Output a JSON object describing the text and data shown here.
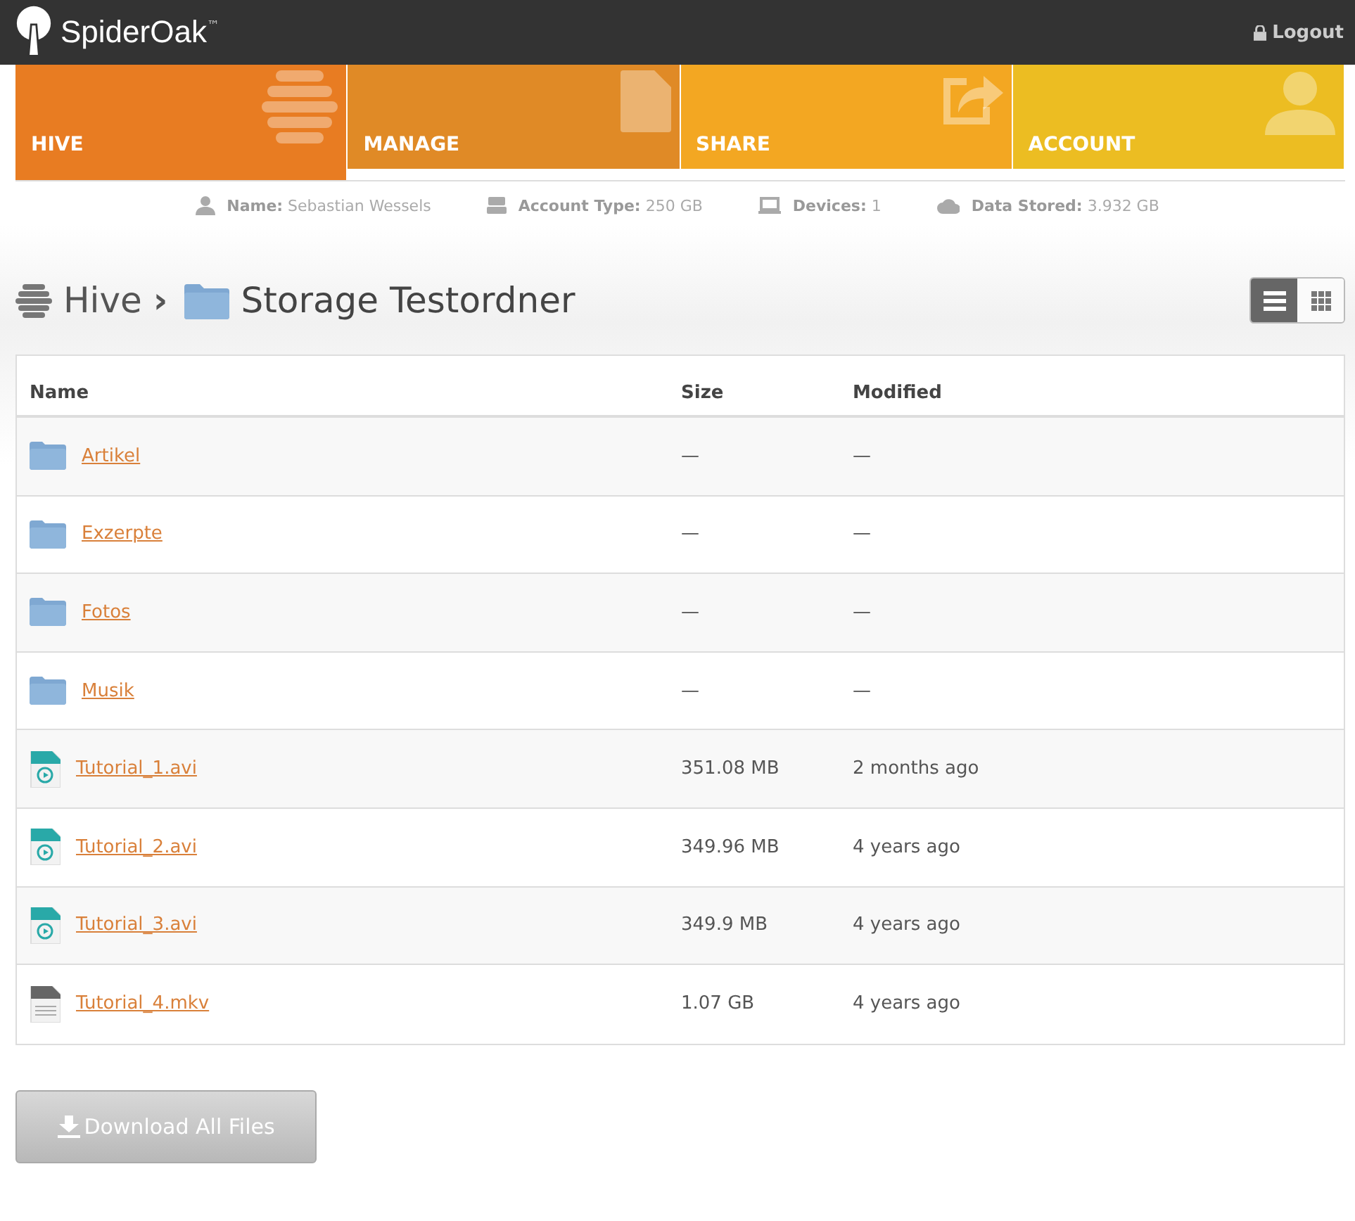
{
  "header": {
    "brand": "SpiderOak",
    "trademark": "™",
    "logout": "Logout"
  },
  "tabs": [
    {
      "label": "HIVE",
      "selected": true,
      "color": "#e87c22",
      "kind": "hive"
    },
    {
      "label": "MANAGE",
      "selected": false,
      "color": "#e08a26",
      "kind": "document"
    },
    {
      "label": "SHARE",
      "selected": false,
      "color": "#f3a722",
      "kind": "share"
    },
    {
      "label": "ACCOUNT",
      "selected": false,
      "color": "#ecbd22",
      "kind": "person"
    }
  ],
  "account_info": [
    {
      "kind": "person",
      "label": "Name:",
      "value": "Sebastian Wessels"
    },
    {
      "kind": "drive",
      "label": "Account Type:",
      "value": "250 GB"
    },
    {
      "kind": "laptop",
      "label": "Devices:",
      "value": "1"
    },
    {
      "kind": "cloud",
      "label": "Data Stored:",
      "value": "3.932 GB"
    }
  ],
  "breadcrumb": {
    "root": "Hive",
    "separator": "›",
    "current": "Storage Testordner"
  },
  "view_toggle": [
    {
      "kind": "list",
      "selected": true
    },
    {
      "kind": "grid",
      "selected": false
    }
  ],
  "table": {
    "columns": [
      "Name",
      "Size",
      "Modified"
    ],
    "rows": [
      {
        "kind": "folder",
        "name": "Artikel",
        "size": "—",
        "modified": "—"
      },
      {
        "kind": "folder",
        "name": "Exzerpte",
        "size": "—",
        "modified": "—"
      },
      {
        "kind": "folder",
        "name": "Fotos",
        "size": "—",
        "modified": "—"
      },
      {
        "kind": "folder",
        "name": "Musik",
        "size": "—",
        "modified": "—"
      },
      {
        "kind": "video",
        "name": "Tutorial_1.avi",
        "size": "351.08 MB",
        "modified": "2 months ago"
      },
      {
        "kind": "video",
        "name": "Tutorial_2.avi",
        "size": "349.96 MB",
        "modified": "4 years ago"
      },
      {
        "kind": "video",
        "name": "Tutorial_3.avi",
        "size": "349.9 MB",
        "modified": "4 years ago"
      },
      {
        "kind": "file",
        "name": "Tutorial_4.mkv",
        "size": "1.07 GB",
        "modified": "4 years ago"
      }
    ]
  },
  "download_button": "Download All Files"
}
